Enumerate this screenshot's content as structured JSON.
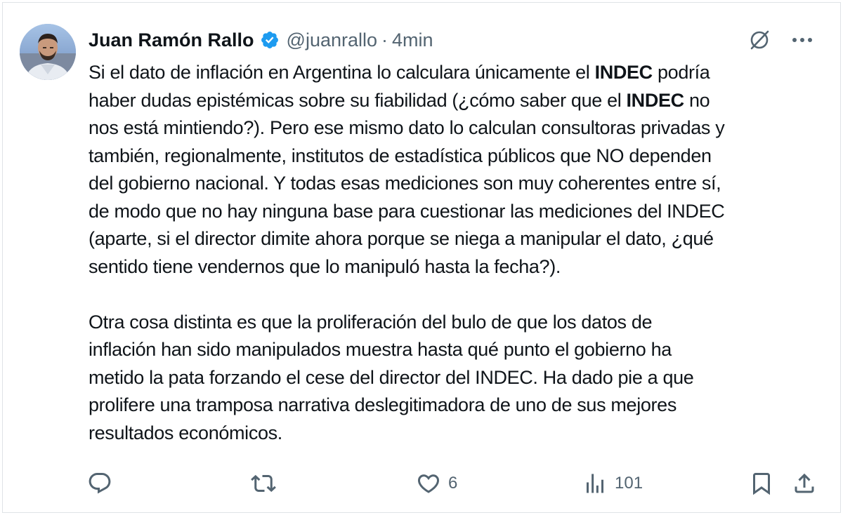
{
  "tweet": {
    "author_name": "Juan Ramón Rallo",
    "handle": "@juanrallo",
    "separator": "·",
    "time": "4min",
    "verified": true,
    "paragraph1": [
      [
        {
          "t": "Si el dato de inflación en Argentina lo calculara únicamente el "
        },
        {
          "t": "INDEC",
          "b": true
        },
        {
          "t": " podría"
        }
      ],
      [
        {
          "t": "haber dudas epistémicas sobre su fiabilidad (¿cómo saber que el "
        },
        {
          "t": "INDEC",
          "b": true
        },
        {
          "t": " no"
        }
      ],
      [
        {
          "t": "nos está mintiendo?). Pero ese mismo dato lo calculan consultoras privadas y"
        }
      ],
      [
        {
          "t": "también, regionalmente, institutos de estadística públicos que NO dependen"
        }
      ],
      [
        {
          "t": "del gobierno nacional. Y todas esas mediciones son muy coherentes entre sí,"
        }
      ],
      [
        {
          "t": "de modo que no hay ninguna base para cuestionar las mediciones del INDEC"
        }
      ],
      [
        {
          "t": "(aparte, si el director dimite ahora porque se niega a manipular el dato, ¿qué"
        }
      ],
      [
        {
          "t": "sentido tiene vendernos que lo manipuló hasta la fecha?)."
        }
      ]
    ],
    "paragraph2": [
      [
        {
          "t": "Otra cosa distinta es que la proliferación del bulo de que los datos de"
        }
      ],
      [
        {
          "t": "inflación han sido manipulados muestra hasta qué punto el gobierno ha"
        }
      ],
      [
        {
          "t": "metido la pata forzando el cese del director del INDEC. Ha dado pie a que"
        }
      ],
      [
        {
          "t": "prolifere una tramposa narrativa deslegitimadora de uno de sus mejores"
        }
      ],
      [
        {
          "t": "resultados económicos."
        }
      ]
    ]
  },
  "actions": {
    "reply_count": "",
    "repost_count": "",
    "like_count": "6",
    "views_count": "101"
  },
  "colors": {
    "text": "#0f1419",
    "secondary": "#536471",
    "verified_badge": "#1d9bf0",
    "border": "#dfe3e6"
  },
  "icons": [
    "avatar",
    "verified-badge-icon",
    "grok-icon",
    "more-icon",
    "reply-icon",
    "repost-icon",
    "like-icon",
    "views-icon",
    "bookmark-icon",
    "share-icon"
  ]
}
